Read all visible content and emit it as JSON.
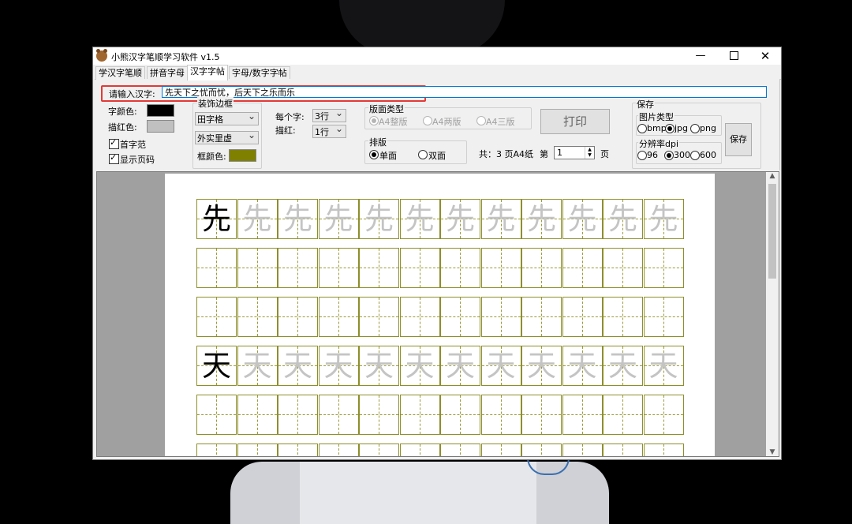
{
  "window": {
    "title": "小熊汉字笔顺学习软件 v1.5",
    "minimize": "—",
    "close": "✕"
  },
  "tabs": [
    "学汉字笔顺",
    "拼音字母",
    "汉字字帖",
    "字母/数字字帖"
  ],
  "active_tab": "汉字字帖",
  "input": {
    "label": "请输入汉字:",
    "value": "先天下之忧而忧，后天下之乐而乐"
  },
  "colors": {
    "char_color_label": "字颜色:",
    "char_color": "#000000",
    "trace_color_label": "描红色:",
    "trace_color": "#c0c0c0",
    "frame_color_label": "框颜色:",
    "frame_color": "#808000"
  },
  "checkboxes": {
    "first_char": "首字范",
    "show_page_number": "显示页码"
  },
  "border": {
    "title": "装饰边框",
    "grid_type": "田字格",
    "frame_style": "外实里虚"
  },
  "per_char": {
    "label": "每个字:",
    "value": "3行",
    "trace_label": "描红:",
    "trace_value": "1行"
  },
  "layout": {
    "title": "版面类型",
    "options": [
      "A4整版",
      "A4两版",
      "A4三版"
    ],
    "selected": "A4整版"
  },
  "print_button": "打印",
  "side": {
    "title": "排版",
    "options": [
      "单面",
      "双面"
    ],
    "selected": "单面"
  },
  "pages": {
    "total": "共：3 页A4纸",
    "page_prefix": "第",
    "page_value": "1",
    "page_suffix": "页"
  },
  "save": {
    "title": "保存",
    "image_type_title": "图片类型",
    "image_types": [
      "bmp",
      "jpg",
      "png"
    ],
    "image_type_selected": "jpg",
    "dpi_title": "分辨率dpi",
    "dpi_options": [
      "96",
      "300",
      "600"
    ],
    "dpi_selected": "300",
    "button": "保存"
  },
  "practice_sheet": [
    {
      "char": "先",
      "trace_count": 11
    },
    {
      "char": "",
      "trace_count": 0
    },
    {
      "char": "",
      "trace_count": 0
    },
    {
      "char": "天",
      "trace_count": 11
    },
    {
      "char": "",
      "trace_count": 0
    },
    {
      "char": "",
      "trace_count": 0
    }
  ]
}
